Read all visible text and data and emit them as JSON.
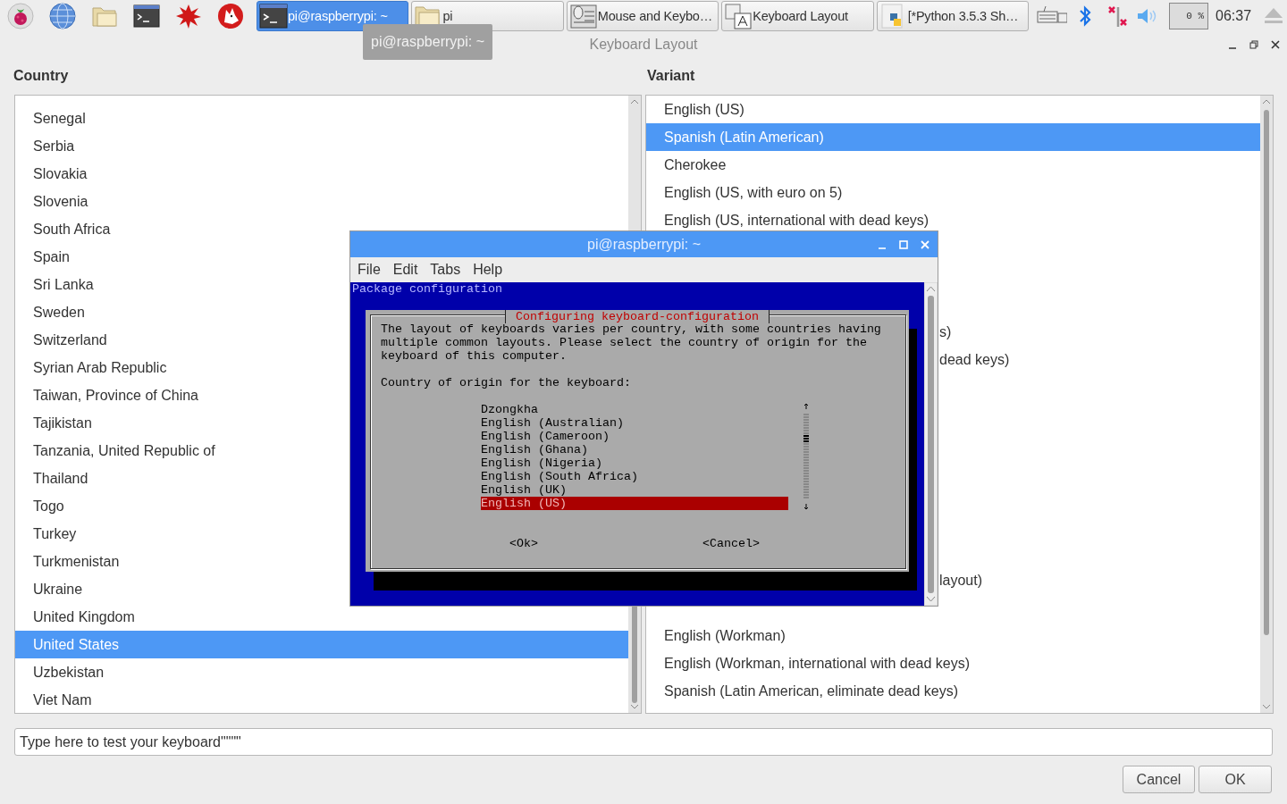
{
  "taskbar": {
    "tasks": [
      {
        "kind": "terminal",
        "label": "pi@raspberrypi: ~",
        "selected": true
      },
      {
        "kind": "folder",
        "label": "pi",
        "selected": false
      },
      {
        "kind": "mouse-keyboard",
        "label": "Mouse and Keybo…",
        "selected": false
      },
      {
        "kind": "keyboard-layout",
        "label": "Keyboard Layout",
        "selected": false
      },
      {
        "kind": "python",
        "label": "[*Python 3.5.3 Sh…",
        "selected": false
      }
    ],
    "cpu": "0 %",
    "clock": "06:37"
  },
  "tooltip": "pi@raspberrypi: ~",
  "window": {
    "title": "Keyboard Layout"
  },
  "country": {
    "label": "Country",
    "items": [
      {
        "label": "Senegal",
        "selected": false
      },
      {
        "label": "Serbia",
        "selected": false
      },
      {
        "label": "Slovakia",
        "selected": false
      },
      {
        "label": "Slovenia",
        "selected": false
      },
      {
        "label": "South Africa",
        "selected": false
      },
      {
        "label": "Spain",
        "selected": false
      },
      {
        "label": "Sri Lanka",
        "selected": false
      },
      {
        "label": "Sweden",
        "selected": false
      },
      {
        "label": "Switzerland",
        "selected": false
      },
      {
        "label": "Syrian Arab Republic",
        "selected": false
      },
      {
        "label": "Taiwan, Province of China",
        "selected": false
      },
      {
        "label": "Tajikistan",
        "selected": false
      },
      {
        "label": "Tanzania, United Republic of",
        "selected": false
      },
      {
        "label": "Thailand",
        "selected": false
      },
      {
        "label": "Togo",
        "selected": false
      },
      {
        "label": "Turkey",
        "selected": false
      },
      {
        "label": "Turkmenistan",
        "selected": false
      },
      {
        "label": "Ukraine",
        "selected": false
      },
      {
        "label": "United Kingdom",
        "selected": false
      },
      {
        "label": "United States",
        "selected": true
      },
      {
        "label": "Uzbekistan",
        "selected": false
      },
      {
        "label": "Viet Nam",
        "selected": false
      }
    ]
  },
  "variant": {
    "label": "Variant",
    "upper_items": [
      {
        "kind": "row",
        "label": "English (US)",
        "selected": false
      },
      {
        "kind": "row",
        "label": "Spanish (Latin American)",
        "selected": true
      },
      {
        "kind": "row",
        "label": "Cherokee",
        "selected": false
      },
      {
        "kind": "row",
        "label": "English (US, with euro on 5)",
        "selected": false
      },
      {
        "kind": "row",
        "label": "English (US, international with dead keys)",
        "selected": false
      },
      {
        "kind": "tail",
        "label": "s)",
        "selected": false
      },
      {
        "kind": "tail",
        "label": "dead keys)",
        "selected": false
      }
    ],
    "lower_items": [
      {
        "kind": "tail",
        "label": "layout)",
        "selected": false
      },
      {
        "kind": "row",
        "label": "English (Workman)",
        "selected": false
      },
      {
        "kind": "row",
        "label": "English (Workman, international with dead keys)",
        "selected": false
      },
      {
        "kind": "row",
        "label": "Spanish (Latin American, eliminate dead keys)",
        "selected": false
      }
    ]
  },
  "test_field": {
    "value": "Type here to test your keyboard\"\"\"\""
  },
  "buttons": [
    "Cancel",
    "OK"
  ],
  "terminal": {
    "title": "pi@raspberrypi: ~",
    "menu": [
      "File",
      "Edit",
      "Tabs",
      "Help"
    ],
    "header": "Package configuration",
    "dialog": {
      "title": "Configuring keyboard-configuration",
      "message_lines": [
        "The layout of keyboards varies per country, with some countries having",
        "multiple common layouts. Please select the country of origin for the",
        "keyboard of this computer."
      ],
      "prompt": "Country of origin for the keyboard:",
      "options": [
        {
          "label": "Dzongkha",
          "selected": false
        },
        {
          "label": "English (Australian)",
          "selected": false
        },
        {
          "label": "English (Cameroon)",
          "selected": false
        },
        {
          "label": "English (Ghana)",
          "selected": false
        },
        {
          "label": "English (Nigeria)",
          "selected": false
        },
        {
          "label": "English (South Africa)",
          "selected": false
        },
        {
          "label": "English (UK)",
          "selected": false
        },
        {
          "label": "English (US)",
          "selected": true
        }
      ],
      "buttons": [
        "<Ok>",
        "<Cancel>"
      ]
    }
  }
}
